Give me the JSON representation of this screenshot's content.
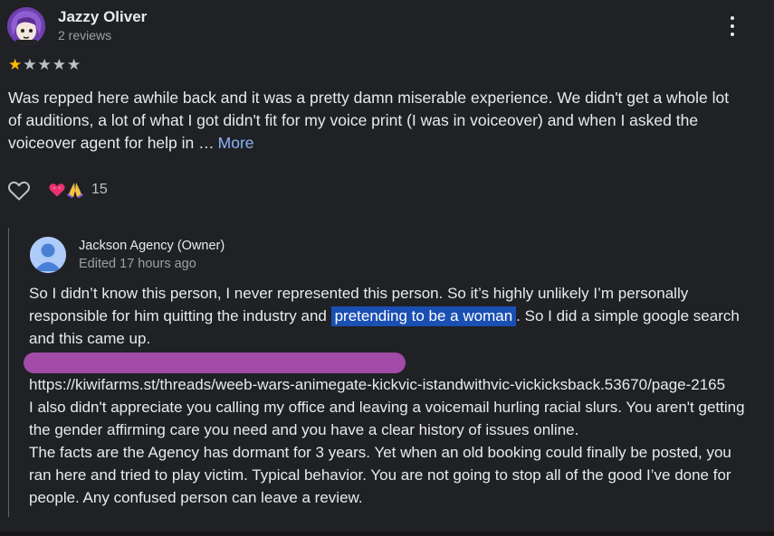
{
  "review": {
    "reviewer_name": "Jazzy Oliver",
    "reviewer_meta": "2 reviews",
    "rating": 1,
    "rating_max": 5,
    "text": "Was repped here awhile back and it was a pretty damn miserable experience. We didn't get a whole lot of auditions, a lot of what I got didn't fit for my voice print (I was in voiceover) and when I asked the voiceover agent for help in …",
    "more_label": "More",
    "reaction_count": "15",
    "star_icon": "star-icon",
    "star_color": "#fbbc04"
  },
  "reply": {
    "owner_name": "Jackson Agency (Owner)",
    "owner_meta": "Edited 17 hours ago",
    "p1_before": "So I didn’t know this person, I never represented this person. So it’s highly unlikely I’m personally responsible for him quitting the industry and ",
    "p1_highlight": "pretending to be a woman",
    "p1_after": ". So I did a simple google search and this came up.",
    "url": "https://kiwifarms.st/threads/weeb-wars-animegate-kickvic-istandwithvic-vickicksback.53670/page-2165",
    "p2": "I also didn't appreciate you calling my office and leaving a voicemail hurling racial slurs. You aren't getting the gender affirming care you need and you have a clear history of issues online.",
    "p3": "The facts are the Agency has dormant for 3 years. Yet when an old booking could finally be posted, you ran here and tried to play victim. Typical behavior. You are not going to stop all of the good I’ve done for people. Any confused person can leave a review.",
    "highlight_color": "#1a4fb3",
    "redaction_color": "#a24aa8"
  }
}
